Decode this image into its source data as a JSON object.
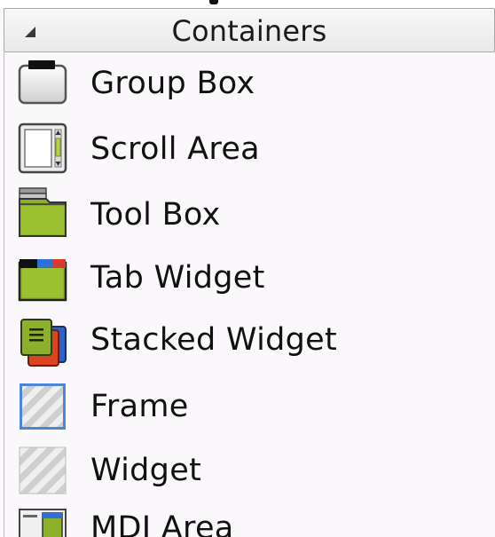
{
  "panel": {
    "category_title": "Containers",
    "items": [
      {
        "label": "Group Box",
        "icon": "group-box-icon"
      },
      {
        "label": "Scroll Area",
        "icon": "scroll-area-icon"
      },
      {
        "label": "Tool Box",
        "icon": "tool-box-icon"
      },
      {
        "label": "Tab Widget",
        "icon": "tab-widget-icon"
      },
      {
        "label": "Stacked Widget",
        "icon": "stacked-widget-icon"
      },
      {
        "label": "Frame",
        "icon": "frame-icon"
      },
      {
        "label": "Widget",
        "icon": "widget-icon"
      },
      {
        "label": "MDI Area",
        "icon": "mdi-area-icon"
      }
    ]
  }
}
